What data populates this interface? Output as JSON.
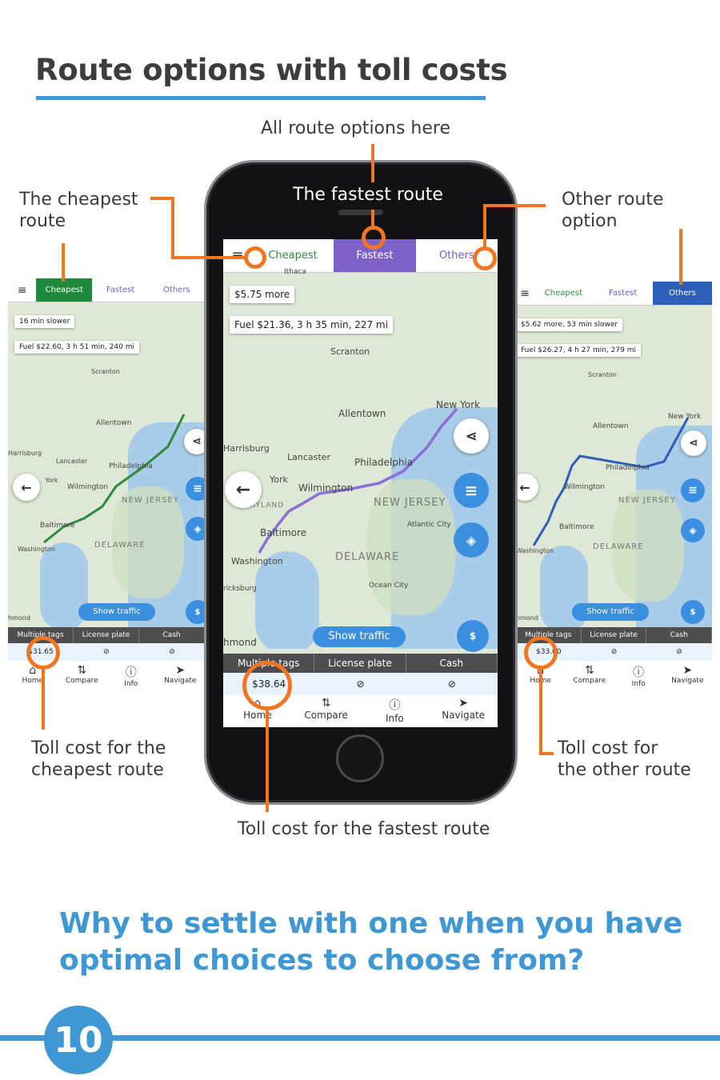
{
  "page": {
    "title": "Route options with toll costs",
    "tagline_line1": "Why to settle with one when you have",
    "tagline_line2": "optimal choices to choose from?",
    "page_number": "10",
    "accent_color": "#3f97d3",
    "callout_color": "#f07622"
  },
  "callouts": {
    "all_options": "All route options here",
    "fastest": "The fastest route",
    "cheapest_line1": "The cheapest",
    "cheapest_line2": "route",
    "other_line1": "Other route",
    "other_line2": "option",
    "toll_cheapest_line1": "Toll cost for the",
    "toll_cheapest_line2": "cheapest route",
    "toll_other_line1": "Toll cost for",
    "toll_other_line2": "the other route",
    "toll_fastest": "Toll cost for the fastest route"
  },
  "tabs": {
    "cheapest": "Cheapest",
    "fastest": "Fastest",
    "others": "Others"
  },
  "toll_headers": {
    "multiple_tags": "Multiple tags",
    "license_plate": "License plate",
    "cash": "Cash"
  },
  "nav": {
    "home": "Home",
    "compare": "Compare",
    "info": "Info",
    "navigate": "Navigate"
  },
  "map_labels": {
    "new_york": "New York",
    "scranton": "Scranton",
    "allentown": "Allentown",
    "harrisburg": "Harrisburg",
    "lancaster": "Lancaster",
    "philadelphia": "Philadelphia",
    "york": "York",
    "wilmington": "Wilmington",
    "baltimore": "Baltimore",
    "washington": "Washington",
    "new_jersey": "NEW JERSEY",
    "delaware": "DELAWARE",
    "maryland": "MARYLAND",
    "atlantic_city": "Atlantic City",
    "ocean_city": "Ocean City",
    "richmond": "hmond",
    "fredericksburg": "ricksburg",
    "ithaca": "Ithaca"
  },
  "show_traffic": "Show traffic",
  "screens": {
    "cheapest": {
      "line1": "16 min slower",
      "line2": "Fuel $22.60, 3 h 51 min, 240 mi",
      "toll": "$31.65",
      "route_color": "#2e8b3e"
    },
    "fastest": {
      "line1": "$5.75 more",
      "line2": "Fuel $21.36, 3 h 35 min, 227 mi",
      "toll": "$38.64",
      "route_color": "#8a6fd4"
    },
    "others": {
      "line1": "$5.62 more, 53 min slower",
      "line2": "Fuel $26.27, 4 h 27 min, 279 mi",
      "toll": "$33.60",
      "route_color": "#2e5fb8"
    }
  }
}
